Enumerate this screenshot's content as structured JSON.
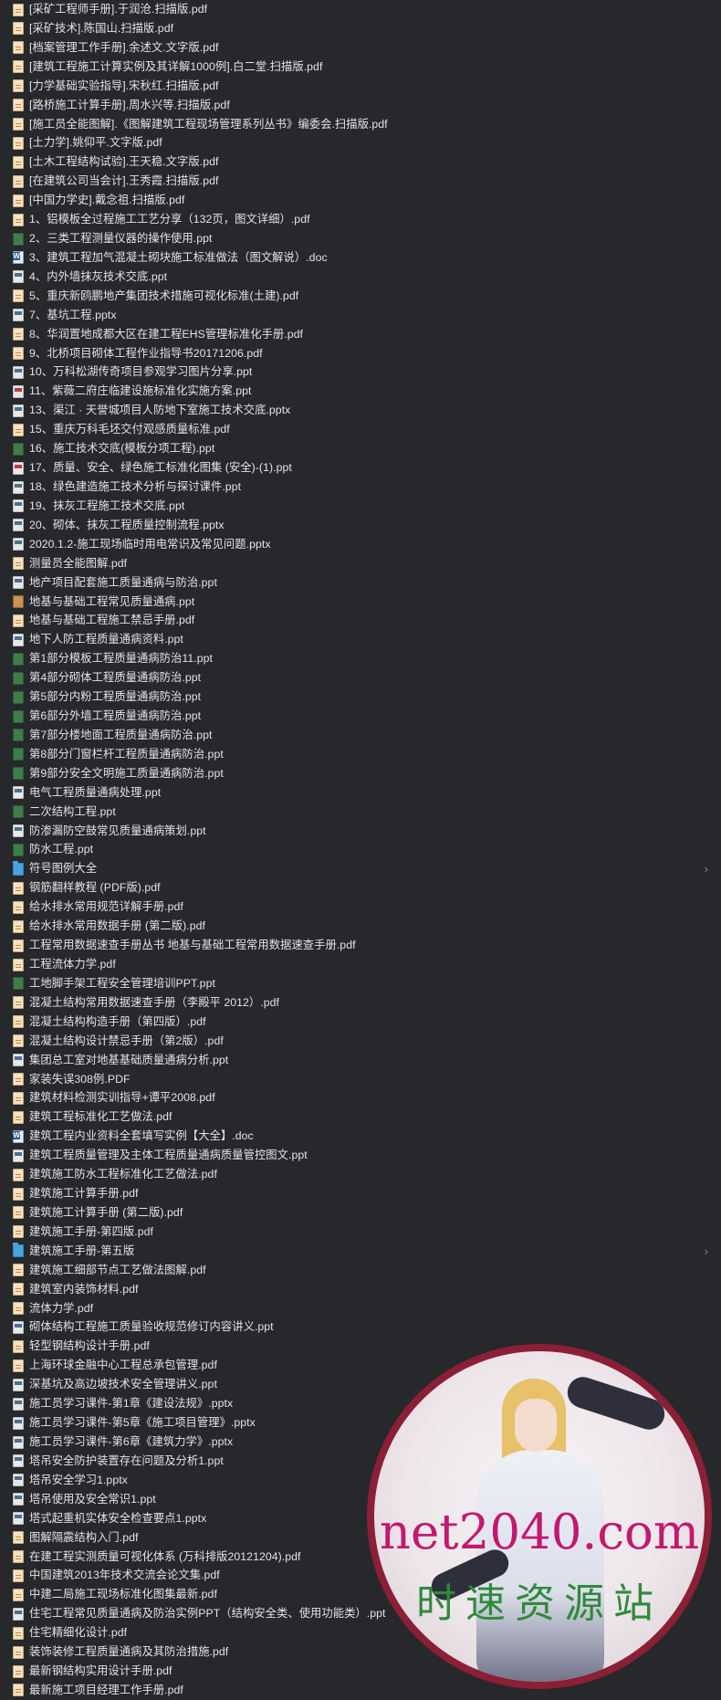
{
  "files": [
    {
      "name": "[采矿工程师手册].于润沧.扫描版.pdf",
      "type": "pdf"
    },
    {
      "name": "[采矿技术].陈国山.扫描版.pdf",
      "type": "pdf"
    },
    {
      "name": "[档案管理工作手册].余述文.文字版.pdf",
      "type": "pdf"
    },
    {
      "name": "[建筑工程施工计算实例及其详解1000例].白二堂.扫描版.pdf",
      "type": "pdf"
    },
    {
      "name": "[力学基础实验指导].宋秋红.扫描版.pdf",
      "type": "pdf"
    },
    {
      "name": "[路桥施工计算手册].周水兴等.扫描版.pdf",
      "type": "pdf"
    },
    {
      "name": "[施工员全能图解].《图解建筑工程现场管理系列丛书》编委会.扫描版.pdf",
      "type": "pdf"
    },
    {
      "name": "[土力学].姚仰平.文字版.pdf",
      "type": "pdf"
    },
    {
      "name": "[土木工程结构试验].王天稳.文字版.pdf",
      "type": "pdf"
    },
    {
      "name": "[在建筑公司当会计].王秀霞.扫描版.pdf",
      "type": "pdf"
    },
    {
      "name": "[中国力学史].戴念祖.扫描版.pdf",
      "type": "pdf"
    },
    {
      "name": "1、铝模板全过程施工工艺分享（132页，图文详细）.pdf",
      "type": "pdf"
    },
    {
      "name": "2、三类工程测量仪器的操作使用.ppt",
      "type": "ppt-green"
    },
    {
      "name": "3、建筑工程加气混凝土砌块施工标准做法（图文解说）.doc",
      "type": "doc"
    },
    {
      "name": "4、内外墙抹灰技术交底.ppt",
      "type": "ppt"
    },
    {
      "name": "5、重庆新鸥鹏地产集团技术措施可视化标准(土建).pdf",
      "type": "pdf"
    },
    {
      "name": "7、基坑工程.pptx",
      "type": "ppt"
    },
    {
      "name": "8、华润置地成都大区在建工程EHS管理标准化手册.pdf",
      "type": "pdf"
    },
    {
      "name": "9、北桥项目砌体工程作业指导书20171206.pdf",
      "type": "pdf"
    },
    {
      "name": "10、万科松湖传奇项目参观学习图片分享.ppt",
      "type": "ppt"
    },
    {
      "name": "11、紫薇二府庄临建设施标准化实施方案.ppt",
      "type": "ppt-red"
    },
    {
      "name": "13、渠江 · 天誉城项目人防地下室施工技术交底.pptx",
      "type": "ppt"
    },
    {
      "name": "15、重庆万科毛坯交付观感质量标准.pdf",
      "type": "pdf"
    },
    {
      "name": "16、施工技术交底(模板分项工程).ppt",
      "type": "ppt-green"
    },
    {
      "name": "17、质量、安全、绿色施工标准化图集 (安全)-(1).ppt",
      "type": "ppt-red"
    },
    {
      "name": "18、绿色建造施工技术分析与探讨课件.ppt",
      "type": "ppt"
    },
    {
      "name": "19、抹灰工程施工技术交底.ppt",
      "type": "ppt"
    },
    {
      "name": "20、砌体、抹灰工程质量控制流程.pptx",
      "type": "ppt"
    },
    {
      "name": "2020.1.2-施工现场临时用电常识及常见问题.pptx",
      "type": "ppt"
    },
    {
      "name": "测量员全能图解.pdf",
      "type": "pdf"
    },
    {
      "name": "地产项目配套施工质量通病与防治.ppt",
      "type": "ppt"
    },
    {
      "name": "地基与基础工程常见质量通病.ppt",
      "type": "ppt-brown"
    },
    {
      "name": "地基与基础工程施工禁忌手册.pdf",
      "type": "pdf"
    },
    {
      "name": "地下人防工程质量通病资料.ppt",
      "type": "ppt"
    },
    {
      "name": "第1部分模板工程质量通病防治11.ppt",
      "type": "ppt-green"
    },
    {
      "name": "第4部分砌体工程质量通病防治.ppt",
      "type": "ppt-green"
    },
    {
      "name": "第5部分内粉工程质量通病防治.ppt",
      "type": "ppt-green"
    },
    {
      "name": "第6部分外墙工程质量通病防治.ppt",
      "type": "ppt-green"
    },
    {
      "name": "第7部分楼地面工程质量通病防治.ppt",
      "type": "ppt-green"
    },
    {
      "name": "第8部分门窗栏杆工程质量通病防治.ppt",
      "type": "ppt-green"
    },
    {
      "name": "第9部分安全文明施工质量通病防治.ppt",
      "type": "ppt-green"
    },
    {
      "name": "电气工程质量通病处理.ppt",
      "type": "ppt"
    },
    {
      "name": "二次结构工程.ppt",
      "type": "ppt-green"
    },
    {
      "name": "防渗漏防空鼓常见质量通病策划.ppt",
      "type": "ppt"
    },
    {
      "name": "防水工程.ppt",
      "type": "ppt-green"
    },
    {
      "name": "符号图例大全",
      "type": "folder",
      "chevron": "›"
    },
    {
      "name": "钢筋翻样教程 (PDF版).pdf",
      "type": "pdf"
    },
    {
      "name": "给水排水常用规范详解手册.pdf",
      "type": "pdf"
    },
    {
      "name": "给水排水常用数据手册 (第二版).pdf",
      "type": "pdf"
    },
    {
      "name": "工程常用数据速查手册丛书 地基与基础工程常用数据速查手册.pdf",
      "type": "pdf"
    },
    {
      "name": "工程流体力学.pdf",
      "type": "pdf"
    },
    {
      "name": "工地脚手架工程安全管理培训PPT.ppt",
      "type": "ppt-green"
    },
    {
      "name": "混凝土结构常用数据速查手册（李殿平 2012）.pdf",
      "type": "pdf"
    },
    {
      "name": "混凝土结构构造手册（第四版）.pdf",
      "type": "pdf"
    },
    {
      "name": "混凝土结构设计禁忌手册（第2版）.pdf",
      "type": "pdf"
    },
    {
      "name": "集团总工室对地基基础质量通病分析.ppt",
      "type": "ppt"
    },
    {
      "name": "家装失误308例.PDF",
      "type": "pdf"
    },
    {
      "name": "建筑材料检测实训指导+谭平2008.pdf",
      "type": "pdf"
    },
    {
      "name": "建筑工程标准化工艺做法.pdf",
      "type": "pdf"
    },
    {
      "name": "建筑工程内业资料全套填写实例【大全】.doc",
      "type": "doc"
    },
    {
      "name": "建筑工程质量管理及主体工程质量通病质量管控图文.ppt",
      "type": "ppt"
    },
    {
      "name": "建筑施工防水工程标准化工艺做法.pdf",
      "type": "pdf"
    },
    {
      "name": "建筑施工计算手册.pdf",
      "type": "pdf"
    },
    {
      "name": "建筑施工计算手册 (第二版).pdf",
      "type": "pdf"
    },
    {
      "name": "建筑施工手册-第四版.pdf",
      "type": "pdf"
    },
    {
      "name": "建筑施工手册-第五版",
      "type": "folder",
      "chevron": "›"
    },
    {
      "name": "建筑施工细部节点工艺做法图解.pdf",
      "type": "pdf"
    },
    {
      "name": "建筑室内装饰材料.pdf",
      "type": "pdf"
    },
    {
      "name": "流体力学.pdf",
      "type": "pdf"
    },
    {
      "name": "砌体结构工程施工质量验收规范修订内容讲义.ppt",
      "type": "ppt"
    },
    {
      "name": "轻型钢结构设计手册.pdf",
      "type": "pdf"
    },
    {
      "name": "上海环球金融中心工程总承包管理.pdf",
      "type": "pdf"
    },
    {
      "name": "深基坑及高边坡技术安全管理讲义.ppt",
      "type": "ppt"
    },
    {
      "name": "施工员学习课件-第1章《建设法规》.pptx",
      "type": "ppt"
    },
    {
      "name": "施工员学习课件-第5章《施工项目管理》.pptx",
      "type": "ppt"
    },
    {
      "name": "施工员学习课件-第6章《建筑力学》.pptx",
      "type": "ppt"
    },
    {
      "name": "塔吊安全防护装置存在问题及分析1.ppt",
      "type": "ppt"
    },
    {
      "name": "塔吊安全学习1.pptx",
      "type": "ppt"
    },
    {
      "name": "塔吊使用及安全常识1.ppt",
      "type": "ppt"
    },
    {
      "name": "塔式起重机实体安全检查要点1.pptx",
      "type": "ppt"
    },
    {
      "name": "图解隔震结构入门.pdf",
      "type": "pdf"
    },
    {
      "name": "在建工程实测质量可视化体系 (万科排版20121204).pdf",
      "type": "pdf"
    },
    {
      "name": "中国建筑2013年技术交流会论文集.pdf",
      "type": "pdf"
    },
    {
      "name": "中建二局施工现场标准化图集最新.pdf",
      "type": "pdf"
    },
    {
      "name": "住宅工程常见质量通病及防治实例PPT（结构安全类、使用功能类）.ppt",
      "type": "ppt"
    },
    {
      "name": "住宅精细化设计.pdf",
      "type": "pdf"
    },
    {
      "name": "装饰装修工程质量通病及其防治措施.pdf",
      "type": "pdf"
    },
    {
      "name": "最新钢结构实用设计手册.pdf",
      "type": "pdf"
    },
    {
      "name": "最新施工项目经理工作手册.pdf",
      "type": "pdf"
    }
  ],
  "watermark": {
    "domain": "net2040.com",
    "brand": "时速资源站"
  },
  "colors": {
    "background": "#26282b",
    "text": "#e4e4e4",
    "folder": "#4aa3df",
    "watermark_domain": "#c3186f",
    "watermark_brand": "#2f8a3b"
  }
}
